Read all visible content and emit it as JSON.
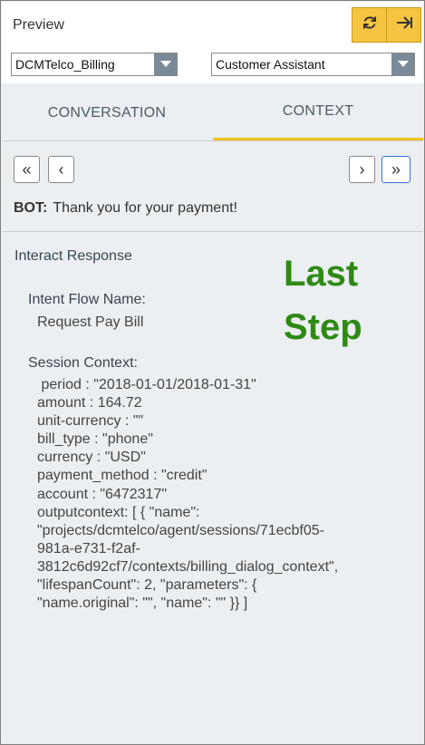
{
  "header": {
    "title": "Preview",
    "refresh_icon": "refresh-icon",
    "forward_icon": "arrow-right-icon",
    "accent_color": "#f5c542"
  },
  "selects": {
    "left_value": "DCMTelco_Billing",
    "right_value": "Customer Assistant"
  },
  "tabs": [
    {
      "label": "CONVERSATION",
      "active": false
    },
    {
      "label": "CONTEXT",
      "active": true
    }
  ],
  "nav": {
    "first": "«",
    "prev": "‹",
    "next": "›",
    "last": "»"
  },
  "bot": {
    "label": "BOT:",
    "message": "Thank you for your payment!"
  },
  "response": {
    "section_title": "Interact Response",
    "annotation_line1": "Last",
    "annotation_line2": "Step",
    "intent_label": "Intent Flow Name:",
    "intent_value": "Request Pay Bill",
    "session_label": "Session Context:",
    "context_lines": [
      " period : \"2018-01-01/2018-01-31\"",
      "amount : 164.72",
      "unit-currency : \"\"",
      "bill_type : \"phone\"",
      "currency : \"USD\"",
      "payment_method : \"credit\"",
      "account : \"6472317\"",
      "outputcontext: [ { \"name\":",
      "\"projects/dcmtelco/agent/sessions/71ecbf05-",
      "981a-e731-f2af-",
      "3812c6d92cf7/contexts/billing_dialog_context\",",
      "\"lifespanCount\": 2, \"parameters\": {",
      "\"name.original\": \"\", \"name\": \"\" }} ]"
    ]
  }
}
